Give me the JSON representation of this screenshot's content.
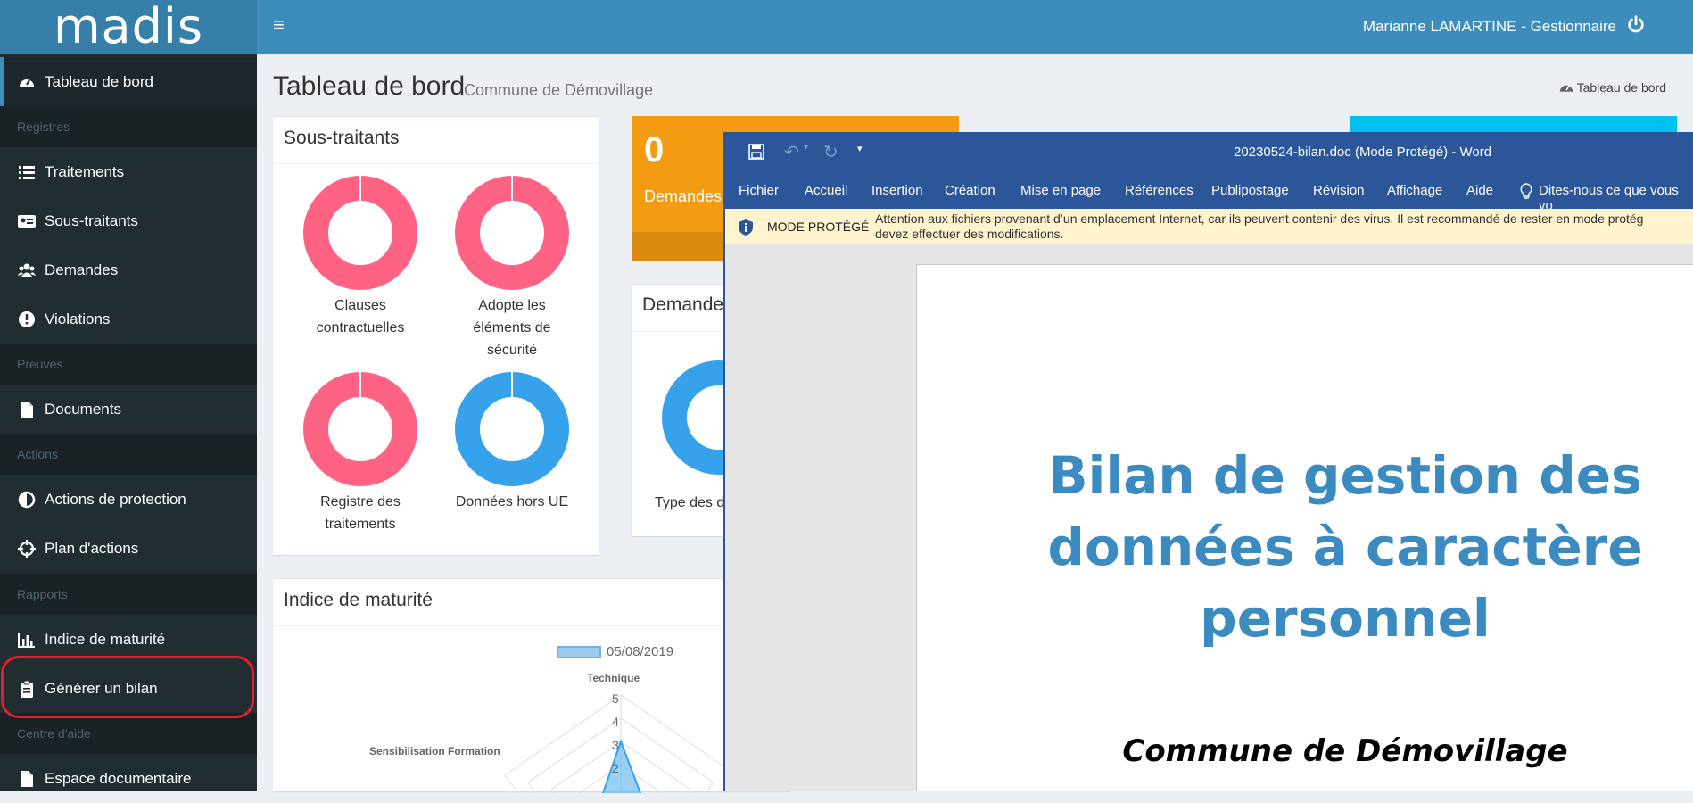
{
  "app": {
    "logo_text": "madis"
  },
  "header": {
    "user": "Marianne LAMARTINE - Gestionnaire"
  },
  "sidebar": {
    "items": [
      {
        "label": "Tableau de bord"
      },
      {
        "label": "Traitements"
      },
      {
        "label": "Sous-traitants"
      },
      {
        "label": "Demandes"
      },
      {
        "label": "Violations"
      },
      {
        "label": "Documents"
      },
      {
        "label": "Actions de protection"
      },
      {
        "label": "Plan d'actions"
      },
      {
        "label": "Indice de maturité"
      },
      {
        "label": "Générer un bilan"
      },
      {
        "label": "Espace documentaire"
      }
    ],
    "sections": [
      "Registres",
      "Preuves",
      "Actions",
      "Rapports",
      "Centre d'aide"
    ]
  },
  "content": {
    "title": "Tableau de bord",
    "subtitle": "Commune de Démovillage",
    "breadcrumb": "Tableau de bord"
  },
  "subcontractors": {
    "title": "Sous-traitants",
    "donuts": [
      {
        "label_lines": [
          "Clauses",
          "contractuelles"
        ],
        "color": "#ff6384"
      },
      {
        "label_lines": [
          "Adopte les",
          "éléments de",
          "sécurité"
        ],
        "color": "#ff6384"
      },
      {
        "label_lines": [
          "Registre des",
          "traitements"
        ],
        "color": "#ff6384"
      },
      {
        "label_lines": [
          "Données hors UE"
        ],
        "color": "#36a2eb"
      }
    ]
  },
  "requests_stat": {
    "value": "0",
    "label": "Demandes a"
  },
  "requests_box": {
    "title": "Demande",
    "type_label": "Type des d"
  },
  "maturity": {
    "title": "Indice de maturité",
    "legend": "05/08/2019",
    "axis_top": "Technique",
    "axis_left": "Sensibilisation Formation",
    "ticks": [
      "5",
      "4",
      "3",
      "2"
    ]
  },
  "word": {
    "title": "20230524-bilan.doc (Mode Protégé)  -  Word",
    "tabs": [
      "Fichier",
      "Accueil",
      "Insertion",
      "Création",
      "Mise en page",
      "Références",
      "Publipostage",
      "Révision",
      "Affichage",
      "Aide",
      "Dites-nous ce que vous vo"
    ],
    "protected_label": "MODE PROTÉGÉ",
    "protected_line1": "Attention aux fichiers provenant d’un emplacement Internet, car ils peuvent contenir des virus. Il est recommandé de rester en mode protég",
    "protected_line2": "devez effectuer des modifications.",
    "doc_title_lines": [
      "Bilan de gestion des",
      "données à caractère",
      "personnel"
    ],
    "doc_subtitle": "Commune de Démovillage"
  },
  "colors": {
    "topbar": "#3c8dbc",
    "sidebar": "#222d32",
    "word_blue": "#2b579a",
    "donut_pink": "#ff6384",
    "donut_blue": "#36a2eb"
  }
}
